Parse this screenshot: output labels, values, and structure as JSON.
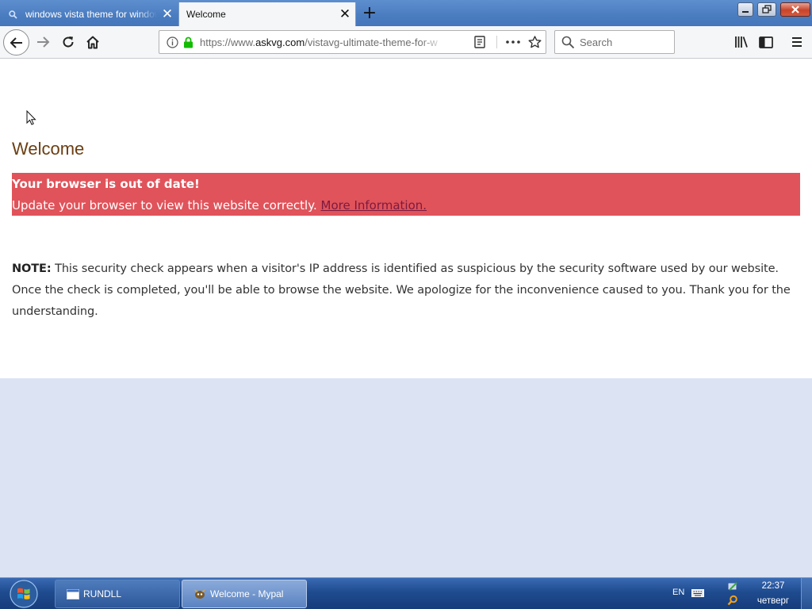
{
  "browser": {
    "tabs": [
      {
        "title": "windows vista theme for windows",
        "active": false,
        "icon": "search-icon"
      },
      {
        "title": "Welcome",
        "active": true
      }
    ],
    "url": {
      "prefix": "https://www.",
      "domain": "askvg.com",
      "path": "/vistavg-ultimate-theme-for-w"
    },
    "search_placeholder": "Search"
  },
  "page": {
    "heading": "Welcome",
    "alert": {
      "title": "Your browser is out of date!",
      "text": "Update your browser to view this website correctly. ",
      "link": "More Information.",
      "bg_color": "#e0535a"
    },
    "note": {
      "label": "NOTE:",
      "text": " This security check appears when a visitor's IP address is identified as suspicious by the security software used by our website. Once the check is completed, you'll be able to browse the website. We apologize for the inconvenience caused to you. Thank you for the understanding."
    }
  },
  "taskbar": {
    "items": [
      {
        "label": "RUNDLL",
        "active": false,
        "icon": "window-icon"
      },
      {
        "label": "Welcome - Mypal",
        "active": true,
        "icon": "mypal-icon"
      }
    ],
    "language": "EN",
    "clock": {
      "time": "22:37",
      "day": "четверг"
    }
  }
}
